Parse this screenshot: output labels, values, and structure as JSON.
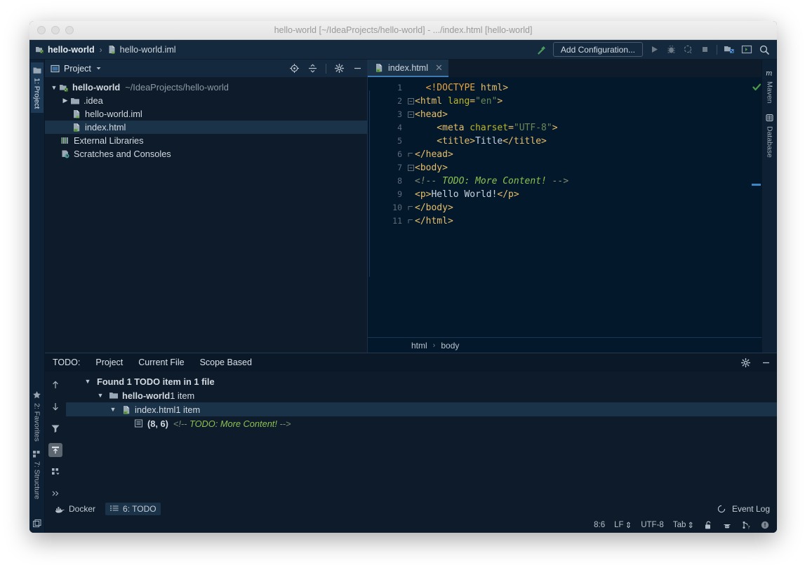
{
  "window": {
    "title": "hello-world [~/IdeaProjects/hello-world] - .../index.html [hello-world]"
  },
  "navbar": {
    "crumbs": [
      {
        "label": "hello-world",
        "icon": "module-icon"
      },
      {
        "label": "hello-world.iml",
        "icon": "iml-file-icon"
      }
    ],
    "separator": "›",
    "build_icon": "hammer-icon",
    "run_config_label": "Add Configuration...",
    "run_icon": "run-icon",
    "debug_icon": "debug-icon",
    "profile_icon": "run-with-coverage-icon",
    "stop_icon": "stop-icon",
    "project_structure_icon": "project-structure-icon",
    "terminal_icon": "terminal-icon",
    "search_icon": "search-everywhere-icon"
  },
  "left_rail": {
    "top": [
      {
        "label": "1: Project",
        "icon": "project-icon",
        "selected": true
      }
    ],
    "bottom": [
      {
        "label": "2: Favorites",
        "icon": "star-icon",
        "selected": false
      },
      {
        "label": "7: Structure",
        "icon": "structure-icon",
        "selected": false
      }
    ],
    "corner_icon": "layout-toggle-icon"
  },
  "right_rail": {
    "items": [
      {
        "label": "Maven",
        "icon": "maven-icon"
      },
      {
        "label": "Database",
        "icon": "database-icon"
      }
    ]
  },
  "project_pane": {
    "title": "Project",
    "title_icon": "project-view-icon",
    "dropdown_icon": "chevron-down-icon",
    "actions": [
      {
        "name": "locate-icon"
      },
      {
        "name": "collapse-all-icon"
      },
      {
        "name": "gear-icon"
      },
      {
        "name": "minimize-icon"
      }
    ],
    "tree": [
      {
        "level": 0,
        "arrow": "▼",
        "icon": "module-icon",
        "label": "hello-world",
        "bold": true,
        "dim": "~/IdeaProjects/hello-world",
        "selected": false
      },
      {
        "level": 1,
        "arrow": "▶",
        "icon": "folder-icon",
        "label": ".idea",
        "bold": false,
        "dim": "",
        "selected": false
      },
      {
        "level": 2,
        "arrow": "",
        "icon": "iml-file-icon",
        "label": "hello-world.iml",
        "bold": false,
        "dim": "",
        "selected": false
      },
      {
        "level": 2,
        "arrow": "",
        "icon": "html-file-icon",
        "label": "index.html",
        "bold": false,
        "dim": "",
        "selected": true
      },
      {
        "level": 1,
        "arrow": "",
        "icon": "libraries-icon",
        "label": "External Libraries",
        "bold": false,
        "dim": "",
        "selected": false
      },
      {
        "level": 1,
        "arrow": "",
        "icon": "scratches-icon",
        "label": "Scratches and Consoles",
        "bold": false,
        "dim": "",
        "selected": false
      }
    ]
  },
  "editor": {
    "tab": {
      "label": "index.html",
      "icon": "html-file-icon",
      "close_icon": "close-icon"
    },
    "line_numbers": [
      "1",
      "2",
      "3",
      "4",
      "5",
      "6",
      "7",
      "8",
      "9",
      "10",
      "11"
    ],
    "breadcrumbs": [
      "html",
      "body"
    ],
    "breadcrumb_separator": "›",
    "inspection_icon": "inspection-ok-icon",
    "lines": [
      {
        "n": 1,
        "fold": "",
        "tokens": [
          {
            "t": "punct",
            "s": "  <!DOCTYPE "
          },
          {
            "t": "tag",
            "s": "html>"
          }
        ]
      },
      {
        "n": 2,
        "fold": "open",
        "tokens": [
          {
            "t": "tag",
            "s": "<html "
          },
          {
            "t": "attr",
            "s": "lang"
          },
          {
            "t": "tag",
            "s": "="
          },
          {
            "t": "str",
            "s": "\"en\""
          },
          {
            "t": "tag",
            "s": ">"
          }
        ]
      },
      {
        "n": 3,
        "fold": "open",
        "tokens": [
          {
            "t": "tag",
            "s": "<head>"
          }
        ]
      },
      {
        "n": 4,
        "fold": "",
        "tokens": [
          {
            "t": "tag",
            "s": "    <meta "
          },
          {
            "t": "attr",
            "s": "charset"
          },
          {
            "t": "tag",
            "s": "="
          },
          {
            "t": "str",
            "s": "\"UTF-8\""
          },
          {
            "t": "tag",
            "s": ">"
          }
        ]
      },
      {
        "n": 5,
        "fold": "",
        "tokens": [
          {
            "t": "tag",
            "s": "    <title>"
          },
          {
            "t": "text",
            "s": "Title"
          },
          {
            "t": "tag",
            "s": "</title>"
          }
        ]
      },
      {
        "n": 6,
        "fold": "close",
        "tokens": [
          {
            "t": "tag",
            "s": "</head>"
          }
        ]
      },
      {
        "n": 7,
        "fold": "open",
        "tokens": [
          {
            "t": "tag",
            "s": "<body>"
          }
        ]
      },
      {
        "n": 8,
        "fold": "",
        "tokens": [
          {
            "t": "com",
            "s": "<!-- "
          },
          {
            "t": "todo",
            "s": "TODO: More Content!"
          },
          {
            "t": "com",
            "s": " -->"
          }
        ]
      },
      {
        "n": 9,
        "fold": "",
        "tokens": [
          {
            "t": "tag",
            "s": "<p>"
          },
          {
            "t": "text",
            "s": "Hello World!"
          },
          {
            "t": "tag",
            "s": "</p>"
          }
        ]
      },
      {
        "n": 10,
        "fold": "close",
        "tokens": [
          {
            "t": "tag",
            "s": "</body>"
          }
        ]
      },
      {
        "n": 11,
        "fold": "close",
        "tokens": [
          {
            "t": "tag",
            "s": "</html>"
          }
        ]
      }
    ]
  },
  "todo_pane": {
    "lead_label": "TODO:",
    "tabs": [
      {
        "label": "Project",
        "selected": false
      },
      {
        "label": "Current File",
        "selected": false
      },
      {
        "label": "Scope Based",
        "selected": false
      }
    ],
    "actions": [
      {
        "name": "gear-icon"
      },
      {
        "name": "minimize-icon"
      }
    ],
    "toolbar": [
      {
        "name": "previous-occurrence-icon",
        "active": false
      },
      {
        "name": "next-occurrence-icon",
        "active": false
      },
      {
        "name": "filter-icon",
        "active": false
      },
      {
        "name": "export-icon",
        "active": true
      },
      {
        "name": "group-by-icon",
        "active": false
      },
      {
        "name": "overflow-icon",
        "active": false
      }
    ],
    "tree": [
      {
        "level": 0,
        "arrow": "▼",
        "icon": "",
        "label": "Found 1 TODO item in 1 file",
        "bold": true,
        "dim": "",
        "extra": "",
        "selected": false
      },
      {
        "level": 1,
        "arrow": "▼",
        "icon": "folder-icon",
        "label": "hello-world",
        "bold": true,
        "dim": "1 item",
        "extra": "",
        "selected": false
      },
      {
        "level": 2,
        "arrow": "▼",
        "icon": "html-file-icon",
        "label": "index.html",
        "bold": false,
        "dim": "1 item",
        "extra": "",
        "selected": true
      },
      {
        "level": 3,
        "arrow": "",
        "icon": "todo-item-icon",
        "label": "(8, 6)",
        "bold": true,
        "dim": "",
        "extra": "<!-- TODO: More Content! -->",
        "selected": false
      }
    ],
    "todo_prefix": "<!-- ",
    "todo_text": "TODO: More Content!",
    "todo_suffix": " -->"
  },
  "bottom_bar": {
    "items": [
      {
        "label": "Docker",
        "icon": "docker-icon",
        "active": false
      },
      {
        "label": "6: TODO",
        "icon": "todo-window-icon",
        "active": true,
        "mnemonic": "6"
      }
    ],
    "event_log": {
      "label": "Event Log",
      "icon": "event-log-icon"
    }
  },
  "status_bar": {
    "caret": "8:6",
    "line_separator": "LF",
    "encoding": "UTF-8",
    "indent": "Tab",
    "stepper_icon": "⇕",
    "icons": [
      {
        "name": "lock-unlocked-icon"
      },
      {
        "name": "inspection-hector-icon"
      },
      {
        "name": "git-branch-icon"
      },
      {
        "name": "notifications-icon"
      }
    ]
  },
  "colors": {
    "accent_blue": "#3d86c6",
    "selection": "#1b3349",
    "editor_bg": "#04182b",
    "panel_bg": "#0d1b2a",
    "todo_green": "#8cc152",
    "tag_yellow": "#e8bf6a",
    "attr_olive": "#bbb529",
    "string_green": "#6a8759"
  }
}
